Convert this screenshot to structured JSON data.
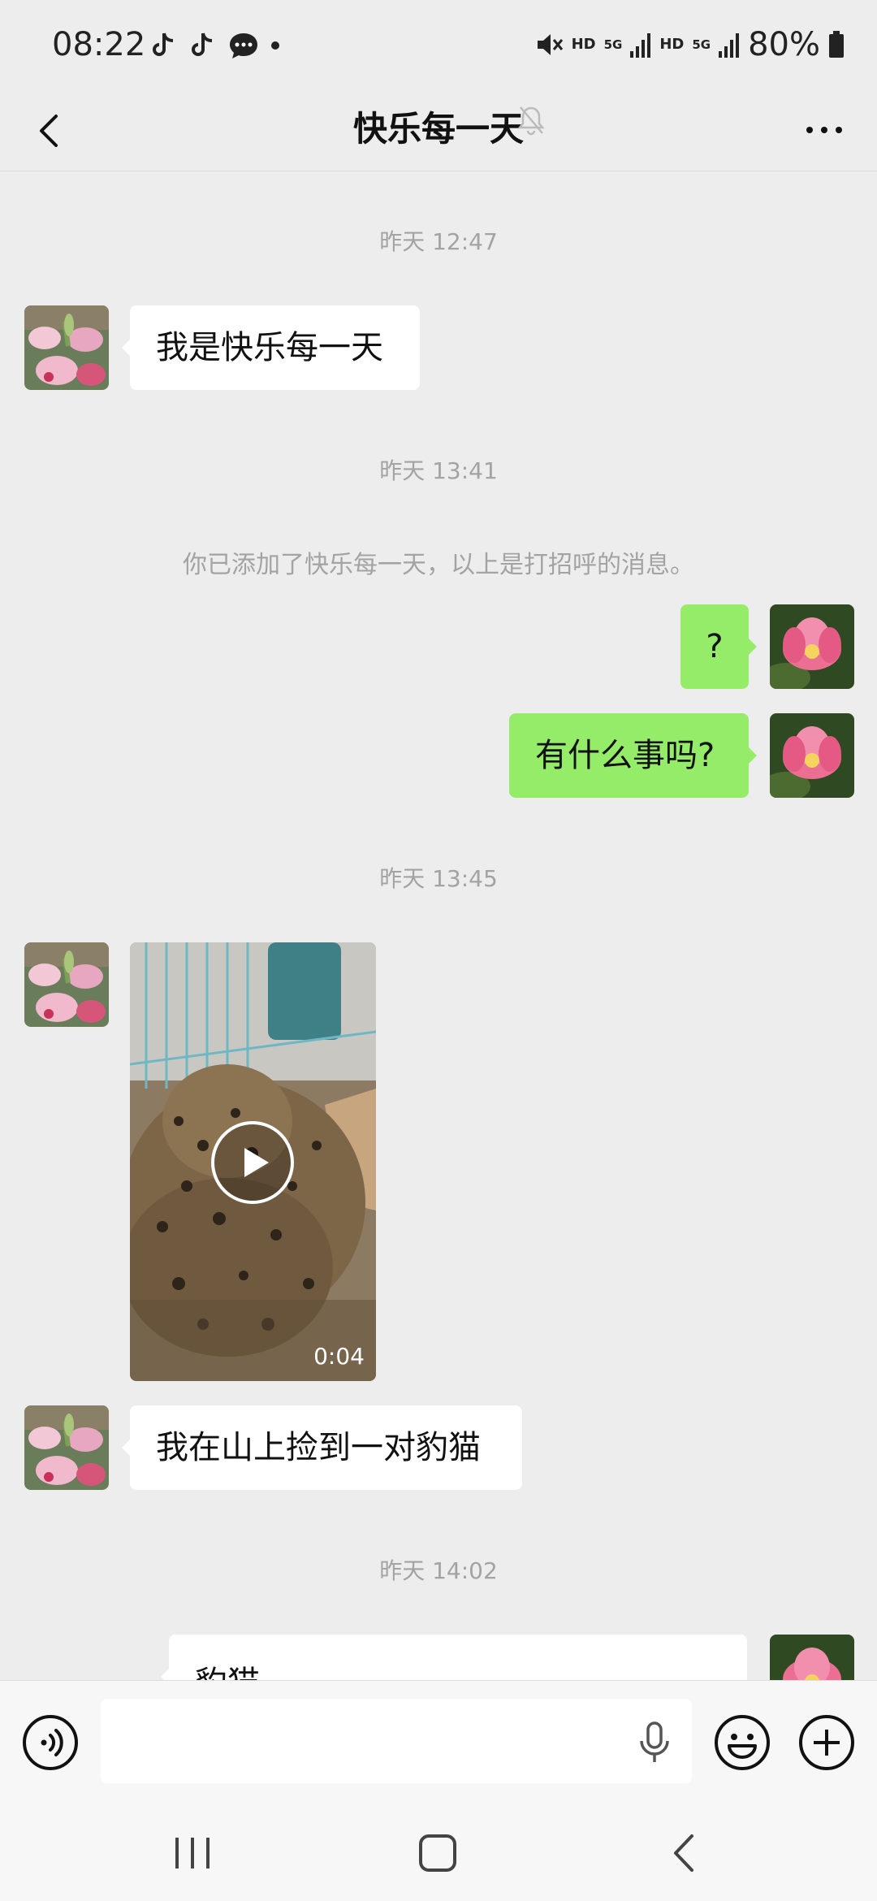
{
  "status_bar": {
    "time": "08:22",
    "battery": "80%",
    "network1": "HD",
    "network1_gen": "5G",
    "network2": "HD",
    "network2_gen": "5G"
  },
  "header": {
    "title": "快乐每一天"
  },
  "messages": {
    "t1": "昨天 12:47",
    "m1": "我是快乐每一天",
    "t2": "昨天 13:41",
    "system": "你已添加了快乐每一天，以上是打招呼的消息。",
    "m2": "?",
    "m3": "有什么事吗?",
    "t3": "昨天 13:45",
    "video_duration": "0:04",
    "m4": "我在山上捡到一对豹猫",
    "t4": "昨天 14:02",
    "m5_partial": "豹猫"
  },
  "colors": {
    "background": "#ededed",
    "outgoing_bubble": "#95ec69",
    "incoming_bubble": "#ffffff",
    "timestamp": "#a3a3a3"
  },
  "icons": [
    "back-arrow-icon",
    "mute-bell-icon",
    "more-icon",
    "voice-icon",
    "microphone-icon",
    "emoji-icon",
    "plus-icon",
    "recent-apps-icon",
    "home-icon",
    "nav-back-icon"
  ]
}
